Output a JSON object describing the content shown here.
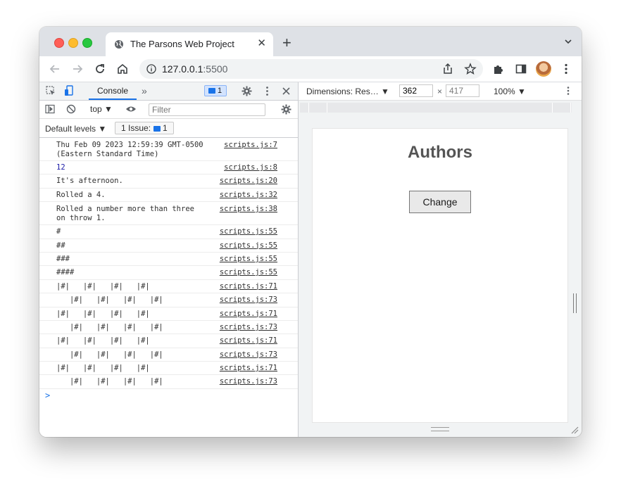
{
  "browser": {
    "tab_title": "The Parsons Web Project",
    "url_host": "127.0.0.1",
    "url_port": ":5500",
    "new_tab_label": "+"
  },
  "devtools": {
    "console_tab": "Console",
    "message_count": "1",
    "context": "top",
    "filter_placeholder": "Filter",
    "levels_label": "Default levels",
    "issue_label": "1 Issue:",
    "issue_count": "1",
    "console_rows": [
      {
        "text": "Thu Feb 09 2023 12:59:39 GMT-0500\n(Eastern Standard Time)",
        "link": "scripts.js:7"
      },
      {
        "text": "12",
        "link": "scripts.js:8"
      },
      {
        "text": "It's afternoon.",
        "link": "scripts.js:20"
      },
      {
        "text": "Rolled a 4.",
        "link": "scripts.js:32"
      },
      {
        "text": "Rolled a number more than three\non throw 1.",
        "link": "scripts.js:38"
      },
      {
        "text": "#",
        "link": "scripts.js:55"
      },
      {
        "text": "##",
        "link": "scripts.js:55"
      },
      {
        "text": "###",
        "link": "scripts.js:55"
      },
      {
        "text": "####",
        "link": "scripts.js:55"
      },
      {
        "text": "|#|   |#|   |#|   |#|",
        "link": "scripts.js:71"
      },
      {
        "text": "   |#|   |#|   |#|   |#|",
        "link": "scripts.js:73"
      },
      {
        "text": "|#|   |#|   |#|   |#|",
        "link": "scripts.js:71"
      },
      {
        "text": "   |#|   |#|   |#|   |#|",
        "link": "scripts.js:73"
      },
      {
        "text": "|#|   |#|   |#|   |#|",
        "link": "scripts.js:71"
      },
      {
        "text": "   |#|   |#|   |#|   |#|",
        "link": "scripts.js:73"
      },
      {
        "text": "|#|   |#|   |#|   |#|",
        "link": "scripts.js:71"
      },
      {
        "text": "   |#|   |#|   |#|   |#|",
        "link": "scripts.js:73"
      }
    ],
    "prompt": ">"
  },
  "emulation": {
    "dimensions_label": "Dimensions: Res…",
    "width": "362",
    "height": "417",
    "x_label": "×",
    "zoom": "100%"
  },
  "page": {
    "heading": "Authors",
    "button_label": "Change"
  },
  "colors": {
    "accent": "#1a73e8",
    "tab_strip": "#dee1e6",
    "heading": "#555555"
  }
}
